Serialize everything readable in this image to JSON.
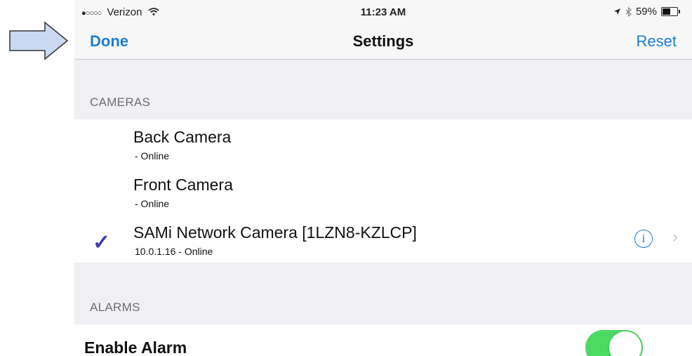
{
  "statusbar": {
    "signal": "●○○○○",
    "carrier": "Verizon",
    "time": "11:23 AM",
    "battery": "59%",
    "battery_level": 0.59
  },
  "navbar": {
    "left": "Done",
    "title": "Settings",
    "right": "Reset"
  },
  "sections": {
    "cameras": {
      "header": "CAMERAS",
      "items": [
        {
          "name": "Back Camera",
          "status": "- Online",
          "selected": false
        },
        {
          "name": "Front Camera",
          "status": "- Online",
          "selected": false
        },
        {
          "name": "SAMi Network Camera [1LZN8-KZLCP]",
          "status": "10.0.1.16 - Online",
          "selected": true
        }
      ]
    },
    "alarms": {
      "header": "ALARMS",
      "enable_alarm": "Enable Alarm",
      "enabled": true
    }
  },
  "icons": {
    "check": "✓",
    "info": "i",
    "chevron": "›"
  },
  "colors": {
    "tint": "#1c7cd5",
    "check": "#3a3ab8",
    "toggle_on": "#4cd964"
  }
}
